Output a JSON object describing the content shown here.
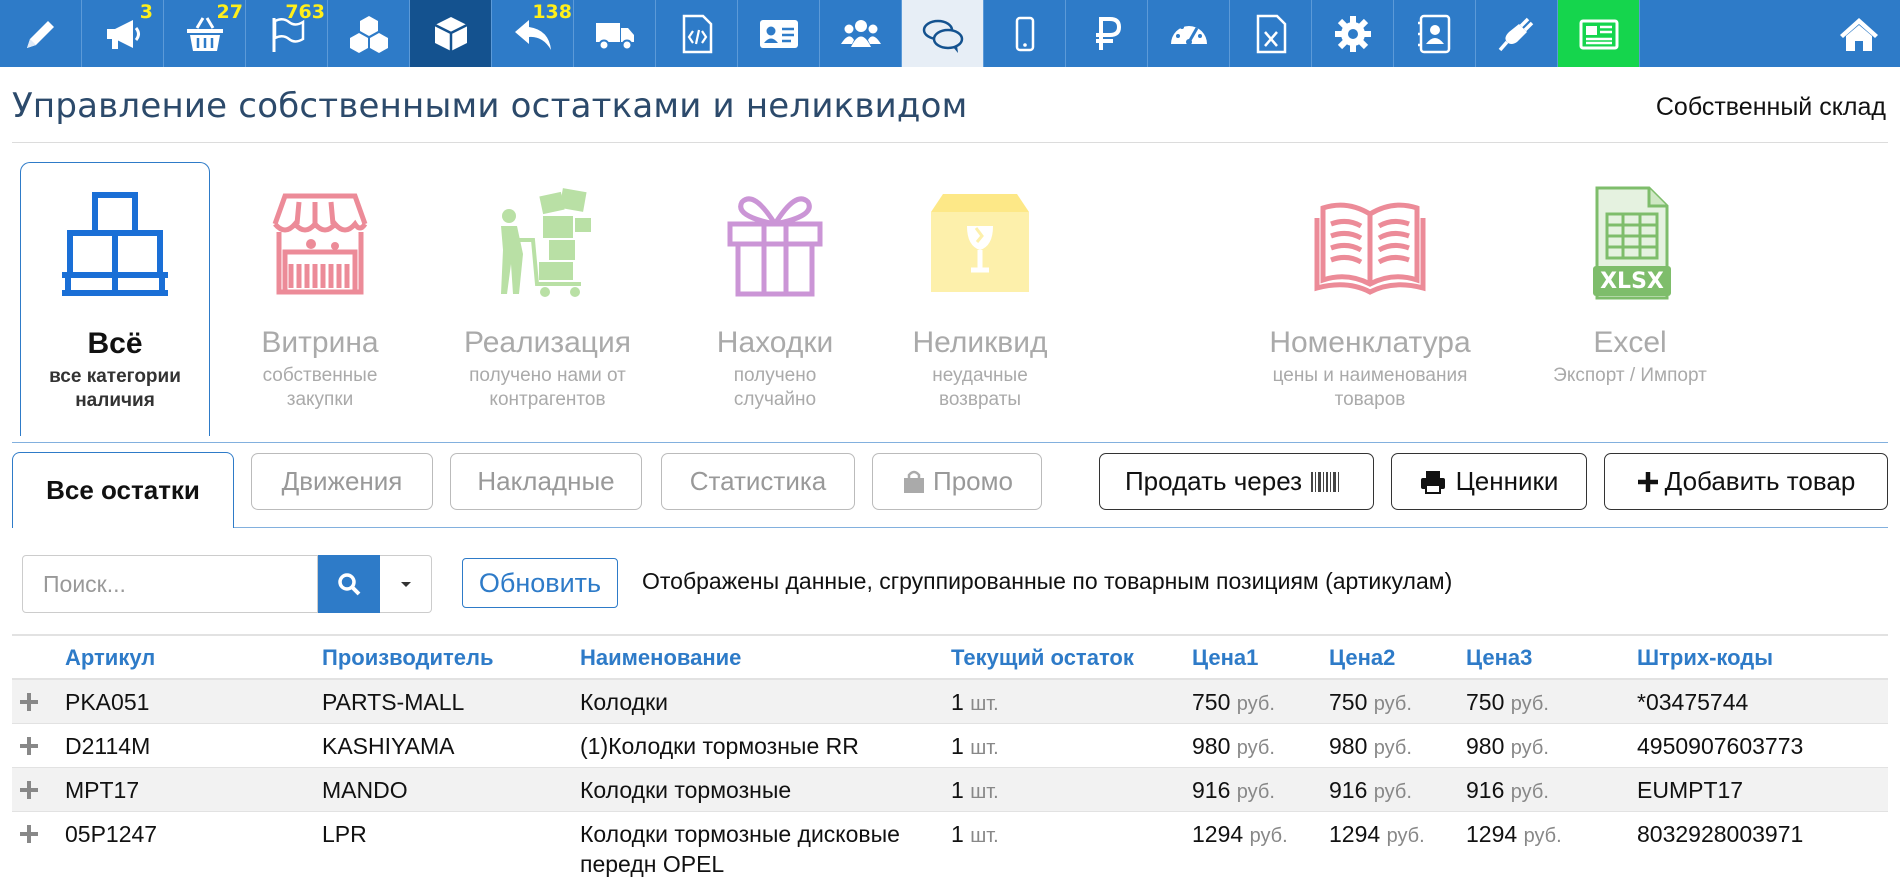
{
  "nav": {
    "badges": {
      "promo": "3",
      "cart": "27",
      "flags": "763",
      "returns": "138"
    }
  },
  "header": {
    "title": "Управление собственными остатками и неликвидом",
    "warehouse": "Собственный склад"
  },
  "categories": [
    {
      "title": "Всё",
      "sub1": "все категории",
      "sub2": "наличия"
    },
    {
      "title": "Витрина",
      "sub1": "собственные",
      "sub2": "закупки"
    },
    {
      "title": "Реализация",
      "sub1": "получено нами от",
      "sub2": "контрагентов"
    },
    {
      "title": "Находки",
      "sub1": "получено",
      "sub2": "случайно"
    },
    {
      "title": "Неликвид",
      "sub1": "неудачные",
      "sub2": "возвраты"
    },
    {
      "title": "Номенклатура",
      "sub1": "цены и наименования",
      "sub2": "товаров"
    },
    {
      "title": "Excel",
      "sub1": "Экспорт / Импорт",
      "sub2": ""
    }
  ],
  "excel_icon_label": "XLSX",
  "tabs": {
    "all": "Все остатки",
    "movements": "Движения",
    "invoices": "Накладные",
    "stats": "Статистика",
    "promo": "Промо",
    "sell": "Продать через",
    "price_tags": "Ценники",
    "add_item": "Добавить товар"
  },
  "search": {
    "placeholder": "Поиск...",
    "refresh": "Обновить",
    "info": "Отображены данные, сгруппированные по товарным позициям (артикулам)"
  },
  "table": {
    "headers": {
      "article": "Артикул",
      "maker": "Производитель",
      "name": "Наименование",
      "stock": "Текущий остаток",
      "price1": "Цена1",
      "price2": "Цена2",
      "price3": "Цена3",
      "barcodes": "Штрих-коды"
    },
    "rows": [
      {
        "article": "PKA051",
        "maker": "PARTS-MALL",
        "name1": "Колодки",
        "name2": "",
        "stock": "1",
        "stock_unit": "шт.",
        "price1": "750",
        "price2": "750",
        "price3": "750",
        "currency": "руб.",
        "barcode": "*03475744"
      },
      {
        "article": "D2114M",
        "maker": "KASHIYAMA",
        "name1": "(1)Колодки тормозные RR",
        "name2": "",
        "stock": "1",
        "stock_unit": "шт.",
        "price1": "980",
        "price2": "980",
        "price3": "980",
        "currency": "руб.",
        "barcode": "4950907603773"
      },
      {
        "article": "MPT17",
        "maker": "MANDO",
        "name1": "Колодки тормозные",
        "name2": "",
        "stock": "1",
        "stock_unit": "шт.",
        "price1": "916",
        "price2": "916",
        "price3": "916",
        "currency": "руб.",
        "barcode": "EUMPT17"
      },
      {
        "article": "05P1247",
        "maker": "LPR",
        "name1": "Колодки тормозные дисковые",
        "name2": "передн OPEL",
        "stock": "1",
        "stock_unit": "шт.",
        "price1": "1294",
        "price2": "1294",
        "price3": "1294",
        "currency": "руб.",
        "barcode": "8032928003971"
      }
    ]
  },
  "colors": {
    "nav": "#2e7bc8",
    "nav_active": "#14528f",
    "nav_green": "#15d54d",
    "badge": "#ffef1a",
    "accent": "#2e7bc8"
  }
}
